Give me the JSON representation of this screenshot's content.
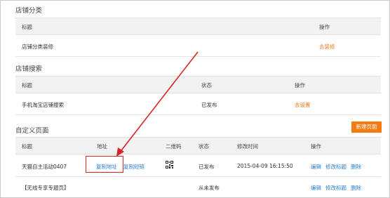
{
  "store_category": {
    "title": "店铺分类",
    "headers": {
      "title": "标题",
      "action": "操作"
    },
    "rows": [
      {
        "name": "店铺分类装修",
        "action": "去装修"
      }
    ]
  },
  "store_search": {
    "title": "店铺搜索",
    "headers": {
      "title": "标题",
      "status": "状态",
      "action": "操作"
    },
    "rows": [
      {
        "name": "手机淘宝店铺搜索",
        "status": "已发布",
        "action": "去设置"
      }
    ]
  },
  "custom_pages": {
    "title": "自定义页面",
    "new_button": "新建页面",
    "headers": {
      "title": "标题",
      "address": "地址",
      "qrcode": "二维码",
      "status": "状态",
      "modified": "修改时间",
      "action": "操作"
    },
    "rows": [
      {
        "name": "天猫自主活动0407",
        "copy_address": "复制地址",
        "copy_short": "复制短链",
        "status": "已发布",
        "modified": "2015-04-09 16:15:50",
        "edit": "编辑",
        "rename": "修改标题",
        "delete": "删除"
      },
      {
        "name": "【无线专享专题页】",
        "status": "从未发布",
        "edit": "编辑",
        "rename": "修改标题",
        "delete": "删除"
      }
    ]
  },
  "colors": {
    "accent_orange": "#f07a10",
    "link_blue": "#2b7fd4",
    "annotation_red": "#d92424"
  },
  "icons": {
    "qrcode": "qrcode-icon"
  }
}
